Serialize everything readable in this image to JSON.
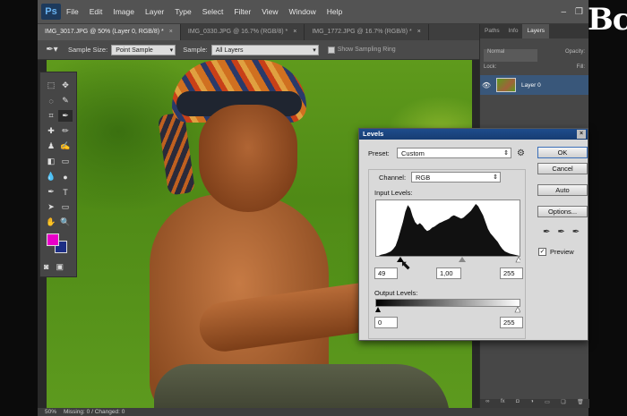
{
  "menu": {
    "logo": "Ps",
    "items": [
      "File",
      "Edit",
      "Image",
      "Layer",
      "Type",
      "Select",
      "Filter",
      "View",
      "Window",
      "Help"
    ]
  },
  "watermark": "Bc",
  "tabs": [
    {
      "label": "IMG_3017.JPG @ 50% (Layer 0, RGB/8) *",
      "active": true
    },
    {
      "label": "IMG_0330.JPG @ 16.7% (RGB/8) *",
      "active": false
    },
    {
      "label": "IMG_1772.JPG @ 16.7% (RGB/8) *",
      "active": false
    }
  ],
  "options": {
    "sample_size_label": "Sample Size:",
    "sample_size_value": "Point Sample",
    "sample_label": "Sample:",
    "sample_value": "All Layers",
    "ring_label": "Show Sampling Ring"
  },
  "status": {
    "zoom": "50%",
    "info": "Missing: 0 / Changed: 0"
  },
  "panels": {
    "tabs": [
      "Paths",
      "Info",
      "Layers"
    ],
    "blend_mode": "Normal",
    "opacity_label": "Opacity:",
    "lock_label": "Lock:",
    "fill_label": "Fill:",
    "layer_name": "Layer 0"
  },
  "levels": {
    "title": "Levels",
    "preset_label": "Preset:",
    "preset_value": "Custom",
    "channel_label": "Channel:",
    "channel_value": "RGB",
    "input_label": "Input Levels:",
    "input_black": "49",
    "input_gamma": "1,00",
    "input_white": "255",
    "output_label": "Output Levels:",
    "output_black": "0",
    "output_white": "255",
    "buttons": {
      "ok": "OK",
      "cancel": "Cancel",
      "auto": "Auto",
      "options": "Options..."
    },
    "preview_label": "Preview",
    "preview_checked": true,
    "histogram": [
      0,
      0,
      2,
      3,
      4,
      6,
      8,
      12,
      18,
      30,
      45,
      60,
      78,
      90,
      84,
      70,
      60,
      55,
      58,
      54,
      48,
      44,
      46,
      50,
      52,
      55,
      58,
      60,
      62,
      64,
      66,
      70,
      72,
      70,
      68,
      66,
      68,
      72,
      76,
      80,
      86,
      92,
      88,
      80,
      72,
      60,
      48,
      40,
      35,
      30,
      25,
      18,
      12,
      8,
      6,
      4,
      3,
      2,
      1,
      0
    ]
  }
}
